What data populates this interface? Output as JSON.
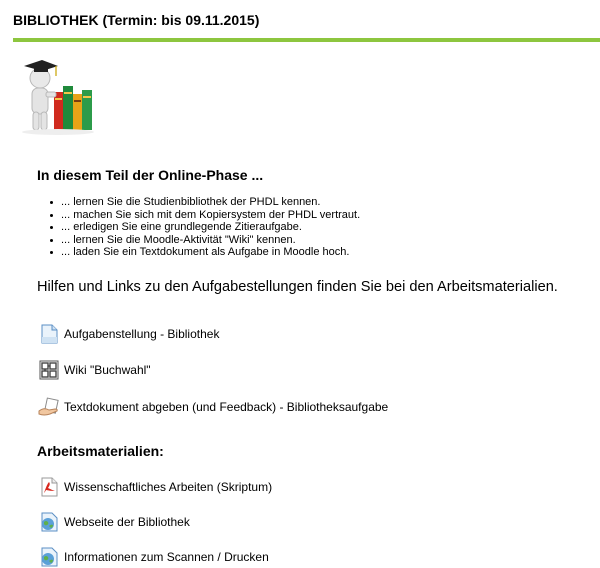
{
  "section": {
    "title": "BIBLIOTHEK (Termin: bis 09.11.2015)"
  },
  "intro": {
    "heading": "In diesem Teil der Online-Phase ...",
    "goals": [
      "... lernen Sie die Studienbibliothek der PHDL kennen.",
      "... machen Sie sich mit dem Kopiersystem der PHDL vertraut.",
      "... erledigen Sie eine grundlegende Zitieraufgabe.",
      "... lernen Sie die Moodle-Aktivität \"Wiki\" kennen.",
      "... laden Sie ein Textdokument als Aufgabe in Moodle hoch."
    ],
    "help_text": "Hilfen und Links zu den Aufgabestellungen finden Sie bei den Arbeitsmaterialien."
  },
  "activities": [
    {
      "label": "Aufgabenstellung - Bibliothek",
      "icon": "page-icon"
    },
    {
      "label": "Wiki \"Buchwahl\"",
      "icon": "wiki-icon"
    },
    {
      "label": "Textdokument abgeben (und Feedback) - Bibliotheksaufgabe",
      "icon": "assignment-icon"
    }
  ],
  "materials": {
    "heading": "Arbeitsmaterialien:",
    "items": [
      {
        "label": "Wissenschaftliches Arbeiten (Skriptum)",
        "icon": "pdf-icon"
      },
      {
        "label": "Webseite der Bibliothek",
        "icon": "globe-icon"
      },
      {
        "label": "Informationen zum Scannen / Drucken",
        "icon": "globe-icon"
      }
    ]
  },
  "colors": {
    "accent_rule": "#8dc63f"
  }
}
